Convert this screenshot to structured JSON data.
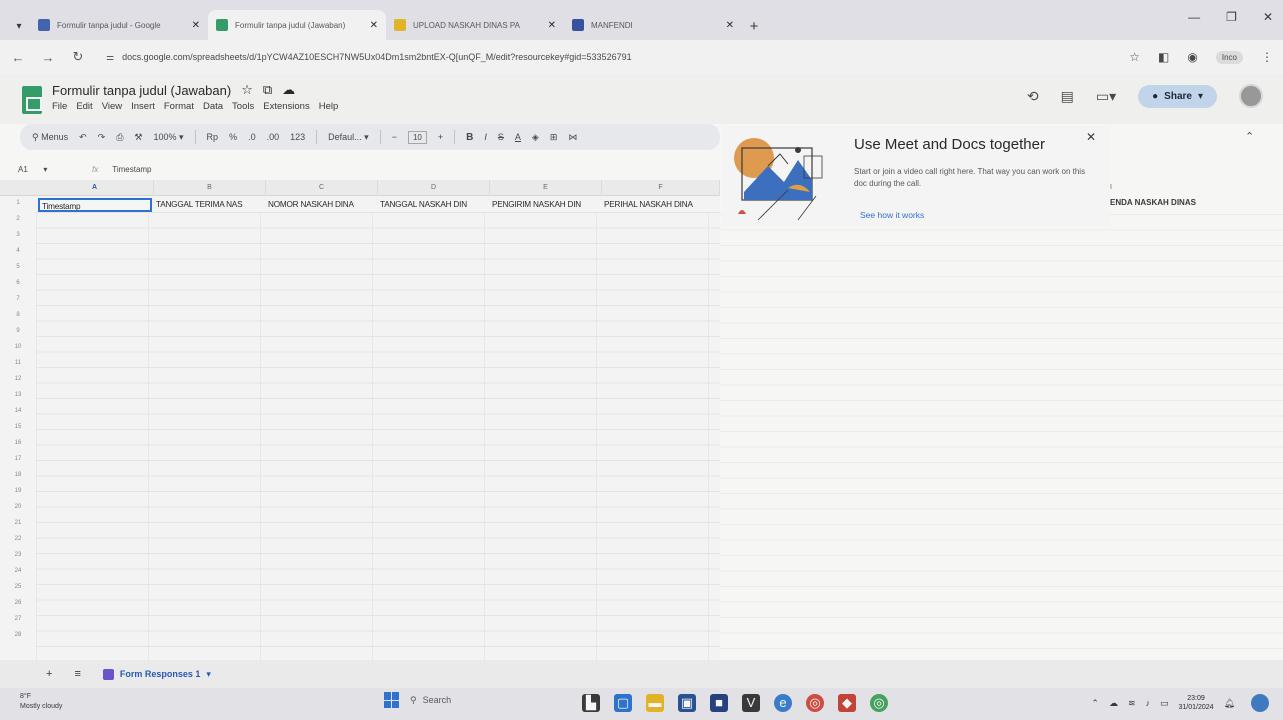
{
  "browser": {
    "tabs": [
      {
        "title": "Formulir tanpa judul - Google",
        "color": "#3b5fc0"
      },
      {
        "title": "Formulir tanpa judul (Jawaban)",
        "color": "#1ea362"
      },
      {
        "title": "UPLOAD NASKAH DINAS PA",
        "color": "#f2b705"
      },
      {
        "title": "MANFENDI",
        "color": "#2a4fb0"
      }
    ],
    "url": "docs.google.com/spreadsheets/d/1pYCW4AZ10ESCH7NW5Ux04Dm1sm2bntEX-Q[unQF_M/edit?resourcekey#gid=533526791",
    "profile_label": "Inco"
  },
  "app": {
    "title": "Formulir tanpa judul (Jawaban)",
    "menu": [
      "File",
      "Edit",
      "View",
      "Insert",
      "Format",
      "Data",
      "Tools",
      "Extensions",
      "Help"
    ],
    "share_label": "Share"
  },
  "toolbar": {
    "menus_label": "Menus",
    "zoom": "100%",
    "currency": "Rp",
    "percent": "%",
    "dec_decrease": ".0",
    "dec_increase": ".00",
    "format_123": "123",
    "font": "Defaul...",
    "font_size": "10",
    "bold": "B",
    "italic": "I",
    "strike": "S",
    "text_color": "A"
  },
  "formula": {
    "cell_ref": "A1",
    "content": "Timestamp"
  },
  "grid": {
    "columns": [
      "A",
      "B",
      "C",
      "D",
      "E",
      "F"
    ],
    "header_row": [
      "Timestamp",
      "TANGGAL TERIMA NAS",
      "NOMOR NASKAH DINA",
      "TANGGAL NASKAH DIN",
      "PENGIRIM NASKAH DIN",
      "PERIHAL NASKAH DINA"
    ],
    "right_column_letter": "I",
    "right_header": "ENDA NASKAH DINAS",
    "row_numbers": [
      "1",
      "2",
      "3",
      "4",
      "5",
      "6",
      "7",
      "8",
      "9",
      "10",
      "11",
      "12",
      "13",
      "14",
      "15",
      "16",
      "17",
      "18",
      "19",
      "20",
      "21",
      "22",
      "23",
      "24",
      "25",
      "26",
      "27",
      "28"
    ]
  },
  "popup": {
    "title": "Use Meet and Docs together",
    "body": "Start or join a video call right here. That way you can work on this doc during the call.",
    "link": "See how it works"
  },
  "sheets": {
    "active_tab": "Form Responses 1"
  },
  "taskbar": {
    "weather_temp": "8°F",
    "weather_desc": "Mostly cloudy",
    "search": "Search",
    "time": "23:09",
    "date": "31/01/2024"
  }
}
